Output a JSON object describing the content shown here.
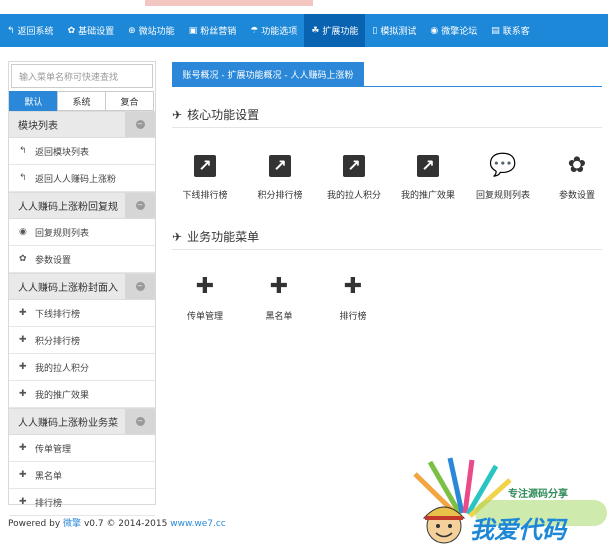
{
  "nav": {
    "items": [
      {
        "icon": "↰",
        "label": "返回系统",
        "active": false
      },
      {
        "icon": "✿",
        "label": "基础设置",
        "active": false
      },
      {
        "icon": "⊕",
        "label": "微站功能",
        "active": false
      },
      {
        "icon": "▣",
        "label": "粉丝营销",
        "active": false
      },
      {
        "icon": "☂",
        "label": "功能选项",
        "active": false
      },
      {
        "icon": "☘",
        "label": "扩展功能",
        "active": true
      },
      {
        "icon": "▯",
        "label": "模拟测试",
        "active": false
      },
      {
        "icon": "◉",
        "label": "微擎论坛",
        "active": false
      },
      {
        "icon": "▤",
        "label": "联系客",
        "active": false
      }
    ]
  },
  "sidebar": {
    "search_placeholder": "输入菜单名称可快速查找",
    "tabs": [
      "默认",
      "系统",
      "复合"
    ],
    "groups": [
      {
        "title": "模块列表",
        "items": [
          {
            "icon": "↰",
            "label": "返回模块列表"
          },
          {
            "icon": "↰",
            "label": "返回人人赚码上涨粉"
          }
        ]
      },
      {
        "title": "人人赚码上涨粉回复规",
        "items": [
          {
            "icon": "◉",
            "label": "回复规则列表"
          },
          {
            "icon": "✿",
            "label": "参数设置"
          }
        ]
      },
      {
        "title": "人人赚码上涨粉封面入",
        "items": [
          {
            "icon": "✚",
            "label": "下线排行榜"
          },
          {
            "icon": "✚",
            "label": "积分排行榜"
          },
          {
            "icon": "✚",
            "label": "我的拉人积分"
          },
          {
            "icon": "✚",
            "label": "我的推广效果"
          }
        ]
      },
      {
        "title": "人人赚码上涨粉业务菜",
        "items": [
          {
            "icon": "✚",
            "label": "传单管理"
          },
          {
            "icon": "✚",
            "label": "黑名单"
          },
          {
            "icon": "✚",
            "label": "排行榜"
          }
        ]
      }
    ]
  },
  "breadcrumb": "账号概况 - 扩展功能概况 - 人人赚码上涨粉",
  "core": {
    "title": "核心功能设置",
    "tiles": [
      {
        "glyph": "↗",
        "label": "下线排行榜"
      },
      {
        "glyph": "↗",
        "label": "积分排行榜"
      },
      {
        "glyph": "↗",
        "label": "我的拉人积分"
      },
      {
        "glyph": "↗",
        "label": "我的推广效果"
      },
      {
        "glyph": "💬",
        "label": "回复规则列表"
      },
      {
        "glyph": "✿",
        "label": "参数设置"
      }
    ]
  },
  "business": {
    "title": "业务功能菜单",
    "tiles": [
      {
        "glyph": "✚",
        "label": "传单管理"
      },
      {
        "glyph": "✚",
        "label": "黑名单"
      },
      {
        "glyph": "✚",
        "label": "排行榜"
      }
    ]
  },
  "footer": {
    "powered": "Powered by",
    "brand": "微擎",
    "version": "v0.7 © 2014-2015",
    "site": "www.we7.cc"
  },
  "watermark": {
    "slogan": "专注源码分享",
    "title": "我爱代码"
  },
  "colors": {
    "nav": "#1e88d8",
    "nav_active": "#0a63b0",
    "accent": "#2b88d8"
  }
}
